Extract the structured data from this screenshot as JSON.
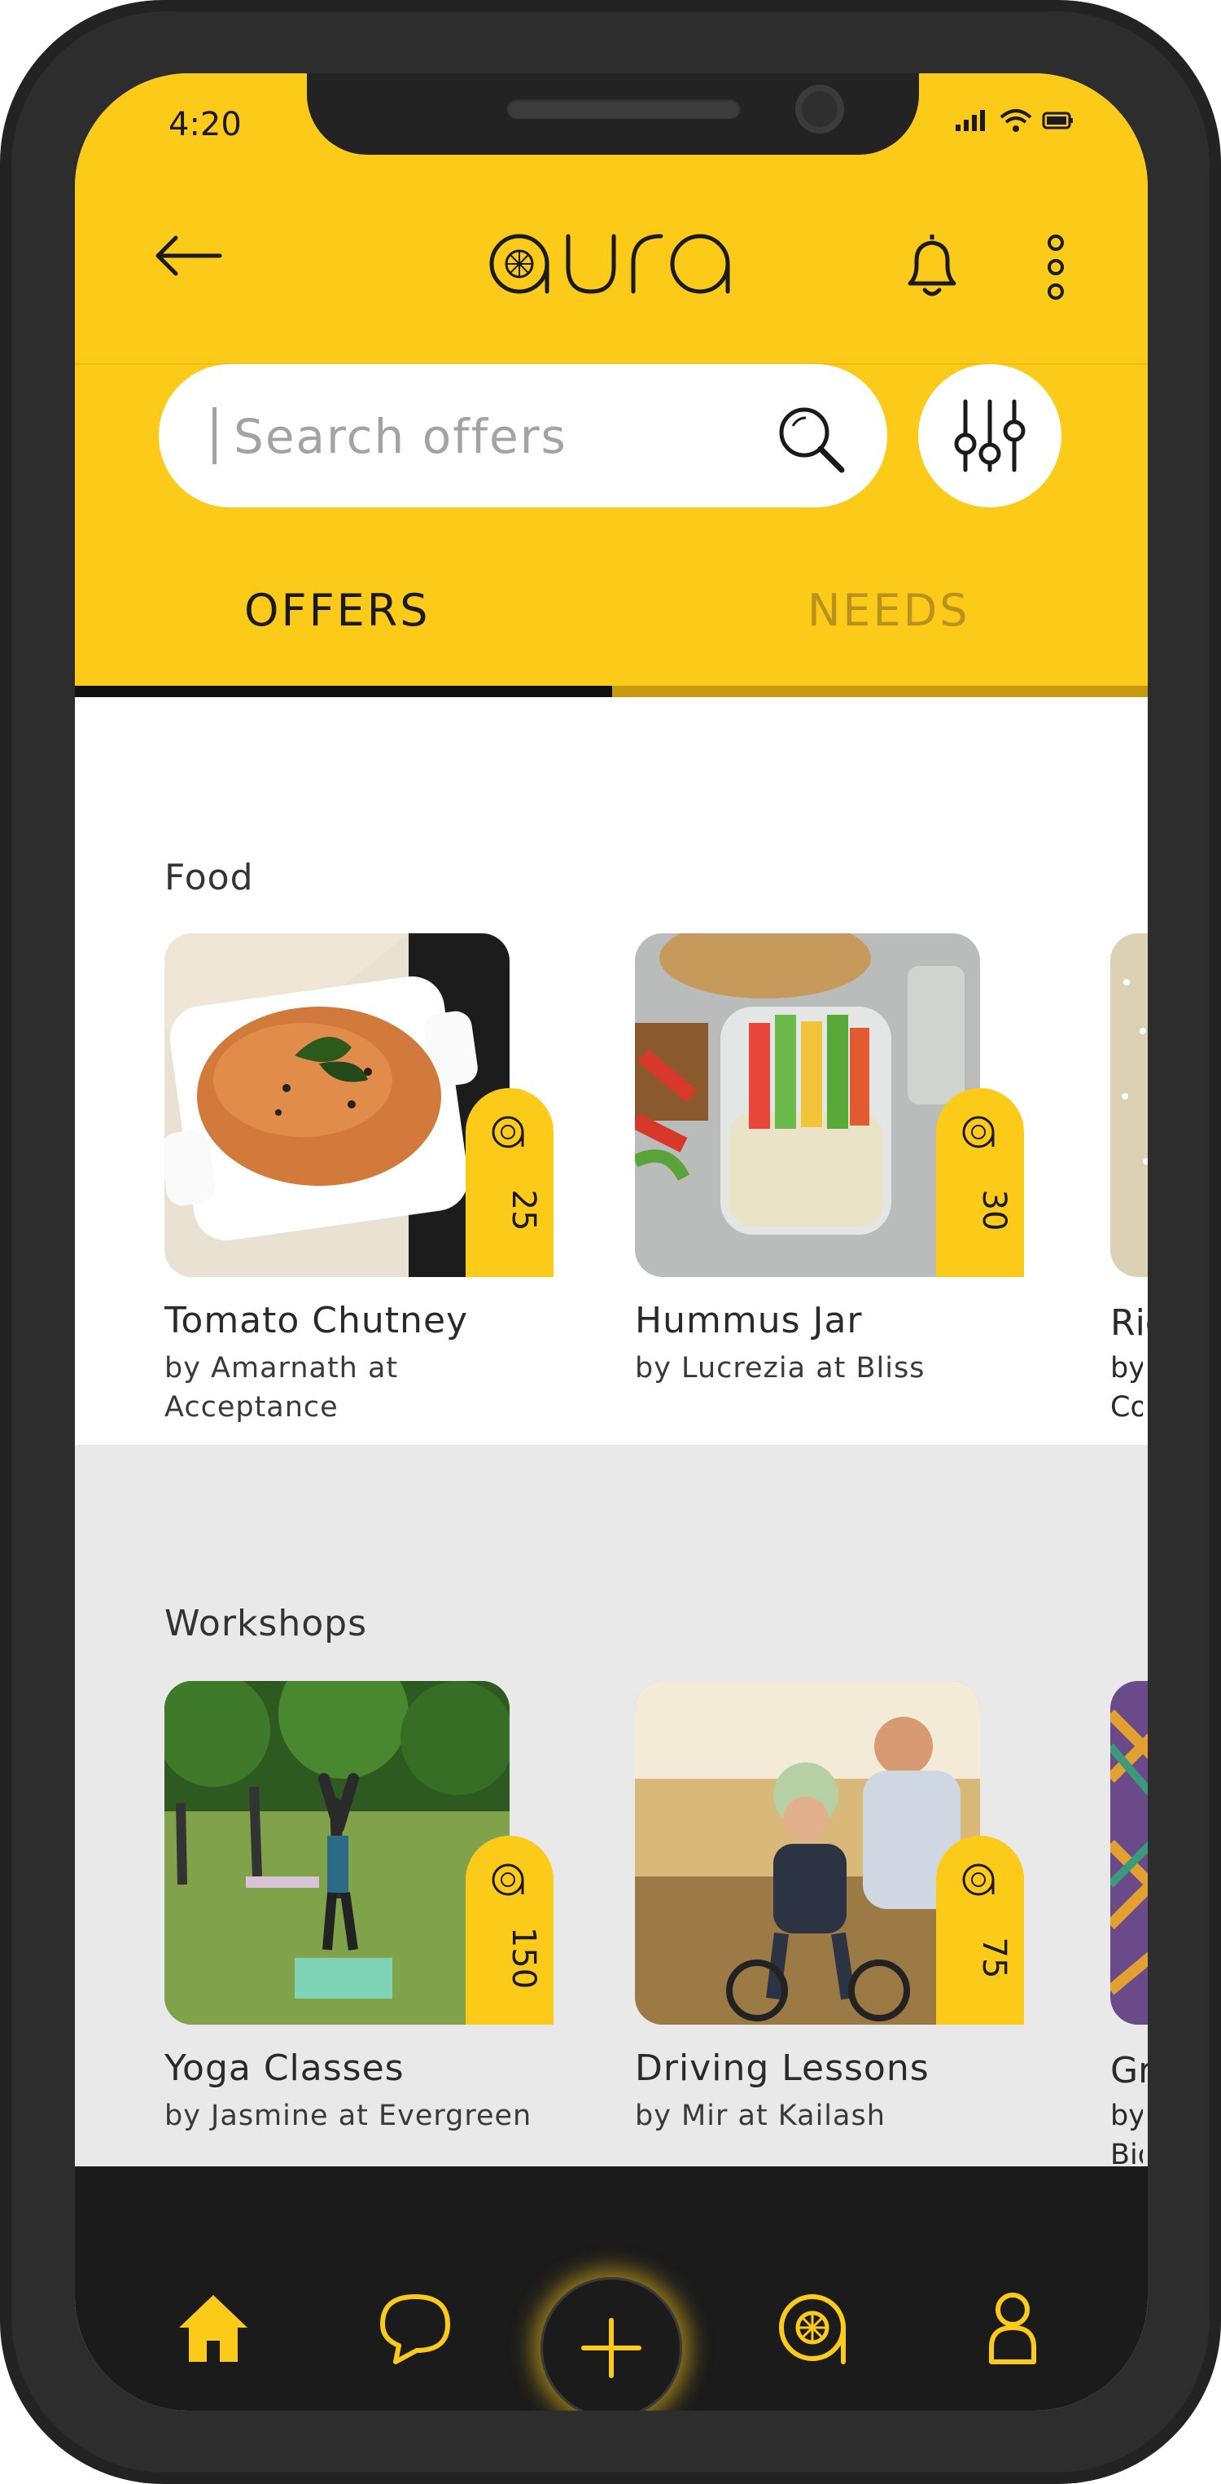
{
  "status": {
    "time": "4:20"
  },
  "app": {
    "logo_text": "aura"
  },
  "search": {
    "placeholder": "Search offers"
  },
  "tabs": [
    {
      "label": "OFFERS",
      "active": true
    },
    {
      "label": "NEEDS",
      "active": false
    }
  ],
  "colors": {
    "accent": "#fccb1a",
    "dark": "#1b1b1b",
    "muted_tab": "#b9921d",
    "section_bg": "#e9e9e9"
  },
  "sections": [
    {
      "title": "Food",
      "cards": [
        {
          "title": "Tomato Chutney",
          "subtitle": "by Amarnath at Acceptance",
          "price": "25"
        },
        {
          "title": "Hummus Jar",
          "subtitle": "by Lucrezia at Bliss",
          "price": "30"
        },
        {
          "title": "Ric",
          "subtitle": "by Co"
        }
      ]
    },
    {
      "title": "Workshops",
      "cards": [
        {
          "title": "Yoga Classes",
          "subtitle": "by Jasmine at Evergreen",
          "price": "150"
        },
        {
          "title": "Driving Lessons",
          "subtitle": "by Mir at Kailash",
          "price": "75"
        },
        {
          "title": "Gr",
          "subtitle": "by Bio"
        }
      ]
    }
  ],
  "nav": {
    "items": [
      "home-icon",
      "chat-icon",
      "add-icon",
      "aura-coin-icon",
      "profile-icon"
    ]
  }
}
